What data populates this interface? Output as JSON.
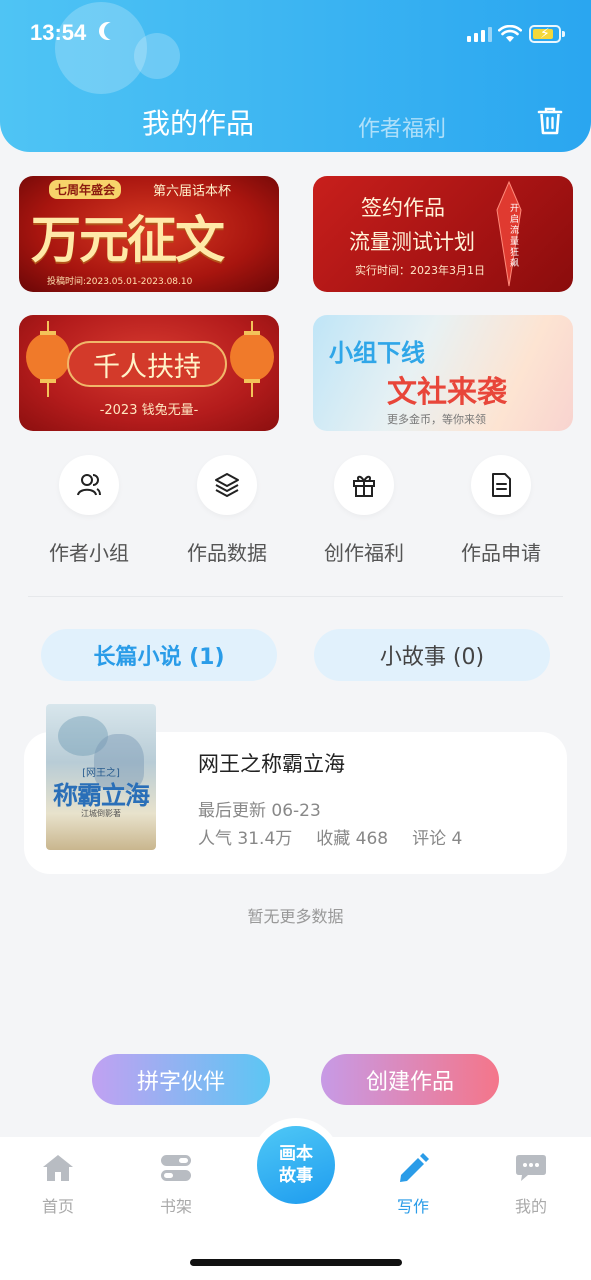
{
  "status": {
    "time": "13:54"
  },
  "header": {
    "tab_works": "我的作品",
    "tab_welfare": "作者福利"
  },
  "banners": {
    "b1": {
      "badge": "七周年盛会",
      "sub": "第六届话本杯",
      "title": "万元征文",
      "date": "投稿时间:2023.05.01-2023.08.10"
    },
    "b2": {
      "title1": "签约作品",
      "title2": "流量测试计划",
      "date": "实行时间：2023年3月1日",
      "side": "开启流量狂飙"
    },
    "b3": {
      "title": "千人扶持",
      "sub": "-2023 钱兔无量-"
    },
    "b4": {
      "title1": "小组下线",
      "title2": "文社来袭",
      "sub": "更多金币，等你来领"
    }
  },
  "shortcuts": [
    {
      "label": "作者小组",
      "icon": "people-icon"
    },
    {
      "label": "作品数据",
      "icon": "layers-icon"
    },
    {
      "label": "创作福利",
      "icon": "gift-icon"
    },
    {
      "label": "作品申请",
      "icon": "document-icon"
    }
  ],
  "filter_tabs": {
    "novel": "长篇小说 (1)",
    "story": "小故事 (0)"
  },
  "book": {
    "cover_title_small": "[网王之]",
    "cover_title": "称霸立海",
    "cover_author": "江城倒影著",
    "title": "网王之称霸立海",
    "updated": "最后更新 06-23",
    "popularity": "人气 31.4万",
    "favorites": "收藏 468",
    "comments": "评论 4"
  },
  "no_more": "暂无更多数据",
  "actions": {
    "partner": "拼字伙伴",
    "create": "创建作品"
  },
  "tabbar": {
    "home": "首页",
    "shelf": "书架",
    "center": "画本故事",
    "write": "写作",
    "mine": "我的"
  },
  "colors": {
    "accent": "#2a9ce8",
    "header": "#3bb4f2"
  }
}
